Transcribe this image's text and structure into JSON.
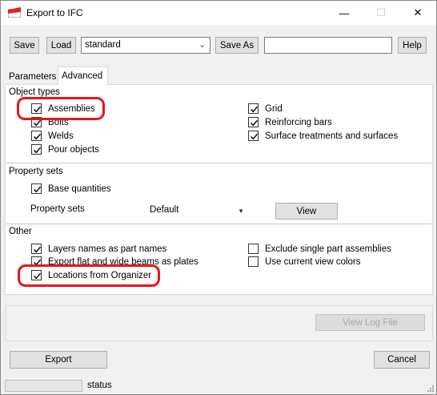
{
  "window": {
    "title": "Export to IFC"
  },
  "toolbar": {
    "save_label": "Save",
    "load_label": "Load",
    "settings_value": "standard",
    "save_as_label": "Save As",
    "save_as_name": "",
    "help_label": "Help"
  },
  "tabs": [
    "Parameters",
    "Advanced"
  ],
  "object_types": {
    "title": "Object types",
    "left": [
      {
        "label": "Assemblies",
        "checked": true
      },
      {
        "label": "Bolts",
        "checked": true
      },
      {
        "label": "Welds",
        "checked": true
      },
      {
        "label": "Pour objects",
        "checked": true
      }
    ],
    "right": [
      {
        "label": "Grid",
        "checked": true
      },
      {
        "label": "Reinforcing bars",
        "checked": true
      },
      {
        "label": "Surface treatments and surfaces",
        "checked": true
      }
    ]
  },
  "property_sets": {
    "title": "Property sets",
    "base_quantities": {
      "label": "Base quantities",
      "checked": true
    },
    "field_label": "Property sets",
    "selected": "Default",
    "view_label": "View"
  },
  "other": {
    "title": "Other",
    "left": [
      {
        "label": "Layers names as part names",
        "checked": true
      },
      {
        "label": "Export flat and wide beams as plates",
        "checked": true
      },
      {
        "label": "Locations from Organizer",
        "checked": true
      }
    ],
    "right": [
      {
        "label": "Exclude single part assemblies",
        "checked": false
      },
      {
        "label": "Use current view colors",
        "checked": false
      }
    ]
  },
  "view_log_label": "View Log File",
  "footer": {
    "export_label": "Export",
    "cancel_label": "Cancel"
  },
  "statusbar": {
    "text": "status"
  },
  "colors": {
    "highlight": "#e8141b",
    "icon_red": "#d8262b"
  }
}
